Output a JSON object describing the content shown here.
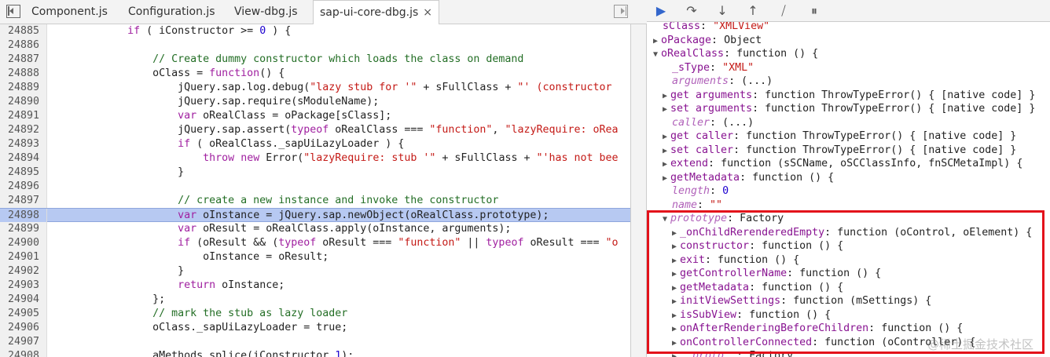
{
  "tabs": [
    {
      "label": "Component.js",
      "active": false
    },
    {
      "label": "Configuration.js",
      "active": false
    },
    {
      "label": "View-dbg.js",
      "active": false
    },
    {
      "label": "sap-ui-core-dbg.js",
      "active": true
    }
  ],
  "close_glyph": "×",
  "editor": {
    "lines": [
      {
        "n": "24885",
        "code": "            if ( iConstructor >= 0 ) {"
      },
      {
        "n": "24886",
        "code": ""
      },
      {
        "n": "24887",
        "code": "                // Create dummy constructor which loads the class on demand"
      },
      {
        "n": "24888",
        "code": "                oClass = function() {"
      },
      {
        "n": "24889",
        "code": "                    jQuery.sap.log.debug(\"lazy stub for '\" + sFullClass + \"' (constructor"
      },
      {
        "n": "24890",
        "code": "                    jQuery.sap.require(sModuleName);"
      },
      {
        "n": "24891",
        "code": "                    var oRealClass = oPackage[sClass];"
      },
      {
        "n": "24892",
        "code": "                    jQuery.sap.assert(typeof oRealClass === \"function\", \"lazyRequire: oRea"
      },
      {
        "n": "24893",
        "code": "                    if ( oRealClass._sapUiLazyLoader ) {"
      },
      {
        "n": "24894",
        "code": "                        throw new Error(\"lazyRequire: stub '\" + sFullClass + \"'has not bee"
      },
      {
        "n": "24895",
        "code": "                    }"
      },
      {
        "n": "24896",
        "code": ""
      },
      {
        "n": "24897",
        "code": "                    // create a new instance and invoke the constructor"
      },
      {
        "n": "24898",
        "code": "                    var oInstance = jQuery.sap.newObject(oRealClass.prototype);",
        "highlight": true
      },
      {
        "n": "24899",
        "code": "                    var oResult = oRealClass.apply(oInstance, arguments);"
      },
      {
        "n": "24900",
        "code": "                    if (oResult && (typeof oResult === \"function\" || typeof oResult === \"o"
      },
      {
        "n": "24901",
        "code": "                        oInstance = oResult;"
      },
      {
        "n": "24902",
        "code": "                    }"
      },
      {
        "n": "24903",
        "code": "                    return oInstance;"
      },
      {
        "n": "24904",
        "code": "                };"
      },
      {
        "n": "24905",
        "code": "                // mark the stub as lazy loader"
      },
      {
        "n": "24906",
        "code": "                oClass._sapUiLazyLoader = true;"
      },
      {
        "n": "24907",
        "code": ""
      },
      {
        "n": "24908",
        "code": "                aMethods.splice(iConstructor,1);"
      }
    ]
  },
  "debugger_toolbar": {
    "buttons": [
      {
        "name": "resume-button",
        "glyph": "▶"
      },
      {
        "name": "step-over-button",
        "glyph": "↷"
      },
      {
        "name": "step-into-button",
        "glyph": "↓"
      },
      {
        "name": "step-out-button",
        "glyph": "↑"
      },
      {
        "name": "deactivate-breakpoints-button",
        "glyph": "⧸"
      },
      {
        "name": "pause-exceptions-button",
        "glyph": "⏸"
      }
    ]
  },
  "scope": {
    "rows": [
      {
        "indent": 0,
        "tri": "",
        "name": "sClass",
        "sep": ": ",
        "value": "\"XMLView\"",
        "vtype": "str"
      },
      {
        "indent": 0,
        "tri": "▶",
        "name": "oPackage",
        "sep": ": ",
        "value": "Object",
        "vtype": "plain"
      },
      {
        "indent": 0,
        "tri": "▼",
        "name": "oRealClass",
        "sep": ": ",
        "value": "function () {",
        "vtype": "plain"
      },
      {
        "indent": 1,
        "tri": "",
        "name": "_sType",
        "sep": ": ",
        "value": "\"XML\"",
        "vtype": "str"
      },
      {
        "indent": 1,
        "tri": "",
        "name": "arguments",
        "sep": ": ",
        "value": "(...)",
        "vtype": "plain",
        "dim": true
      },
      {
        "indent": 1,
        "tri": "▶",
        "name": "get arguments",
        "sep": ": ",
        "value": "function ThrowTypeError() { [native code] }",
        "vtype": "plain"
      },
      {
        "indent": 1,
        "tri": "▶",
        "name": "set arguments",
        "sep": ": ",
        "value": "function ThrowTypeError() { [native code] }",
        "vtype": "plain"
      },
      {
        "indent": 1,
        "tri": "",
        "name": "caller",
        "sep": ": ",
        "value": "(...)",
        "vtype": "plain",
        "dim": true
      },
      {
        "indent": 1,
        "tri": "▶",
        "name": "get caller",
        "sep": ": ",
        "value": "function ThrowTypeError() { [native code] }",
        "vtype": "plain"
      },
      {
        "indent": 1,
        "tri": "▶",
        "name": "set caller",
        "sep": ": ",
        "value": "function ThrowTypeError() { [native code] }",
        "vtype": "plain"
      },
      {
        "indent": 1,
        "tri": "▶",
        "name": "extend",
        "sep": ": ",
        "value": "function (sSCName, oSCClassInfo, fnSCMetaImpl) {",
        "vtype": "plain"
      },
      {
        "indent": 1,
        "tri": "▶",
        "name": "getMetadata",
        "sep": ": ",
        "value": "function () {",
        "vtype": "plain"
      },
      {
        "indent": 1,
        "tri": "",
        "name": "length",
        "sep": ": ",
        "value": "0",
        "vtype": "num",
        "dim": true
      },
      {
        "indent": 1,
        "tri": "",
        "name": "name",
        "sep": ": ",
        "value": "\"\"",
        "vtype": "str",
        "dim": true
      },
      {
        "indent": 1,
        "tri": "▼",
        "name": "prototype",
        "sep": ": ",
        "value": "Factory",
        "vtype": "plain",
        "dim": true
      },
      {
        "indent": 2,
        "tri": "▶",
        "name": "_onChildRerenderedEmpty",
        "sep": ": ",
        "value": "function (oControl, oElement) {",
        "vtype": "plain"
      },
      {
        "indent": 2,
        "tri": "▶",
        "name": "constructor",
        "sep": ": ",
        "value": "function () {",
        "vtype": "plain"
      },
      {
        "indent": 2,
        "tri": "▶",
        "name": "exit",
        "sep": ": ",
        "value": "function () {",
        "vtype": "plain"
      },
      {
        "indent": 2,
        "tri": "▶",
        "name": "getControllerName",
        "sep": ": ",
        "value": "function () {",
        "vtype": "plain"
      },
      {
        "indent": 2,
        "tri": "▶",
        "name": "getMetadata",
        "sep": ": ",
        "value": "function () {",
        "vtype": "plain"
      },
      {
        "indent": 2,
        "tri": "▶",
        "name": "initViewSettings",
        "sep": ": ",
        "value": "function (mSettings) {",
        "vtype": "plain"
      },
      {
        "indent": 2,
        "tri": "▶",
        "name": "isSubView",
        "sep": ": ",
        "value": "function () {",
        "vtype": "plain"
      },
      {
        "indent": 2,
        "tri": "▶",
        "name": "onAfterRenderingBeforeChildren",
        "sep": ": ",
        "value": "function () {",
        "vtype": "plain"
      },
      {
        "indent": 2,
        "tri": "▶",
        "name": "onControllerConnected",
        "sep": ": ",
        "value": "function (oController) {",
        "vtype": "plain"
      },
      {
        "indent": 2,
        "tri": "▶",
        "name": "__proto__",
        "sep": ": ",
        "value": "Factory",
        "vtype": "plain",
        "dim": true
      }
    ]
  },
  "watermark": "@稀土掘金技术社区",
  "colors": {
    "highlight_box": "#e3121b",
    "current_line": "#b7c9f2"
  }
}
